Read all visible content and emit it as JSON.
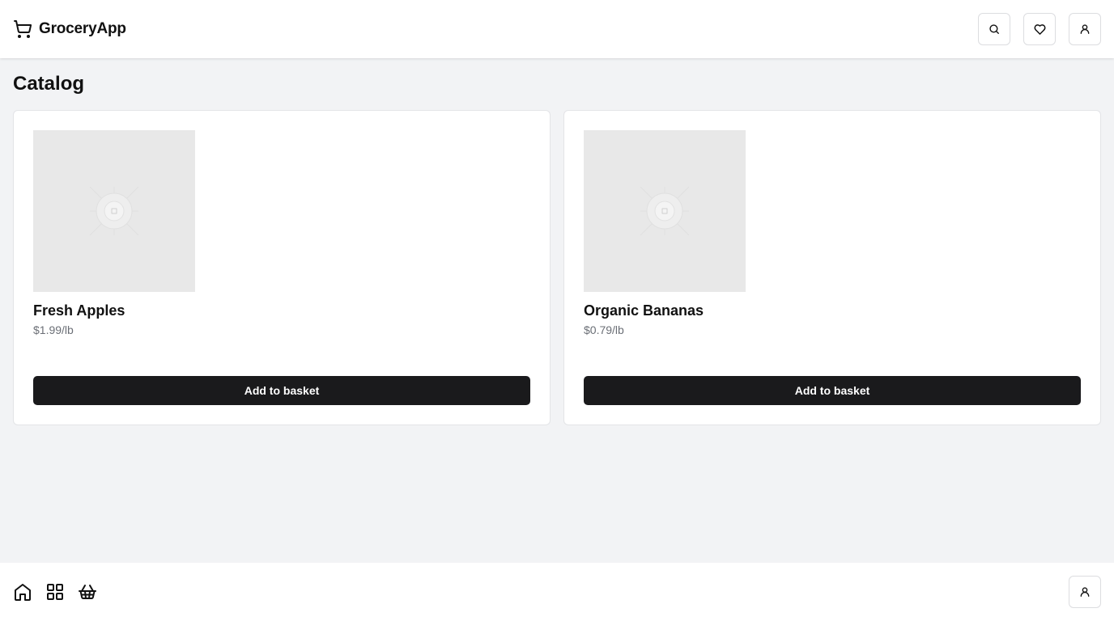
{
  "app": {
    "name": "GroceryApp"
  },
  "header": {
    "icons": [
      "shopping-cart-icon",
      "search-icon",
      "heart-icon",
      "user-icon"
    ]
  },
  "main": {
    "title": "Catalog",
    "products": [
      {
        "name": "Fresh Apples",
        "price": "$1.99/lb",
        "button_label": "Add to basket",
        "image": "image-placeholder-icon"
      },
      {
        "name": "Organic Bananas",
        "price": "$0.79/lb",
        "button_label": "Add to basket",
        "image": "image-placeholder-icon"
      }
    ]
  },
  "bottom_nav": {
    "icons": [
      "home-icon",
      "grid-icon",
      "basket-icon",
      "user-icon"
    ]
  },
  "colors": {
    "background": "#f2f3f5",
    "surface": "#ffffff",
    "button": "#1a1a1c",
    "button_text": "#ffffff",
    "price_text": "#6b6f76",
    "placeholder": "#e8e8e8"
  }
}
